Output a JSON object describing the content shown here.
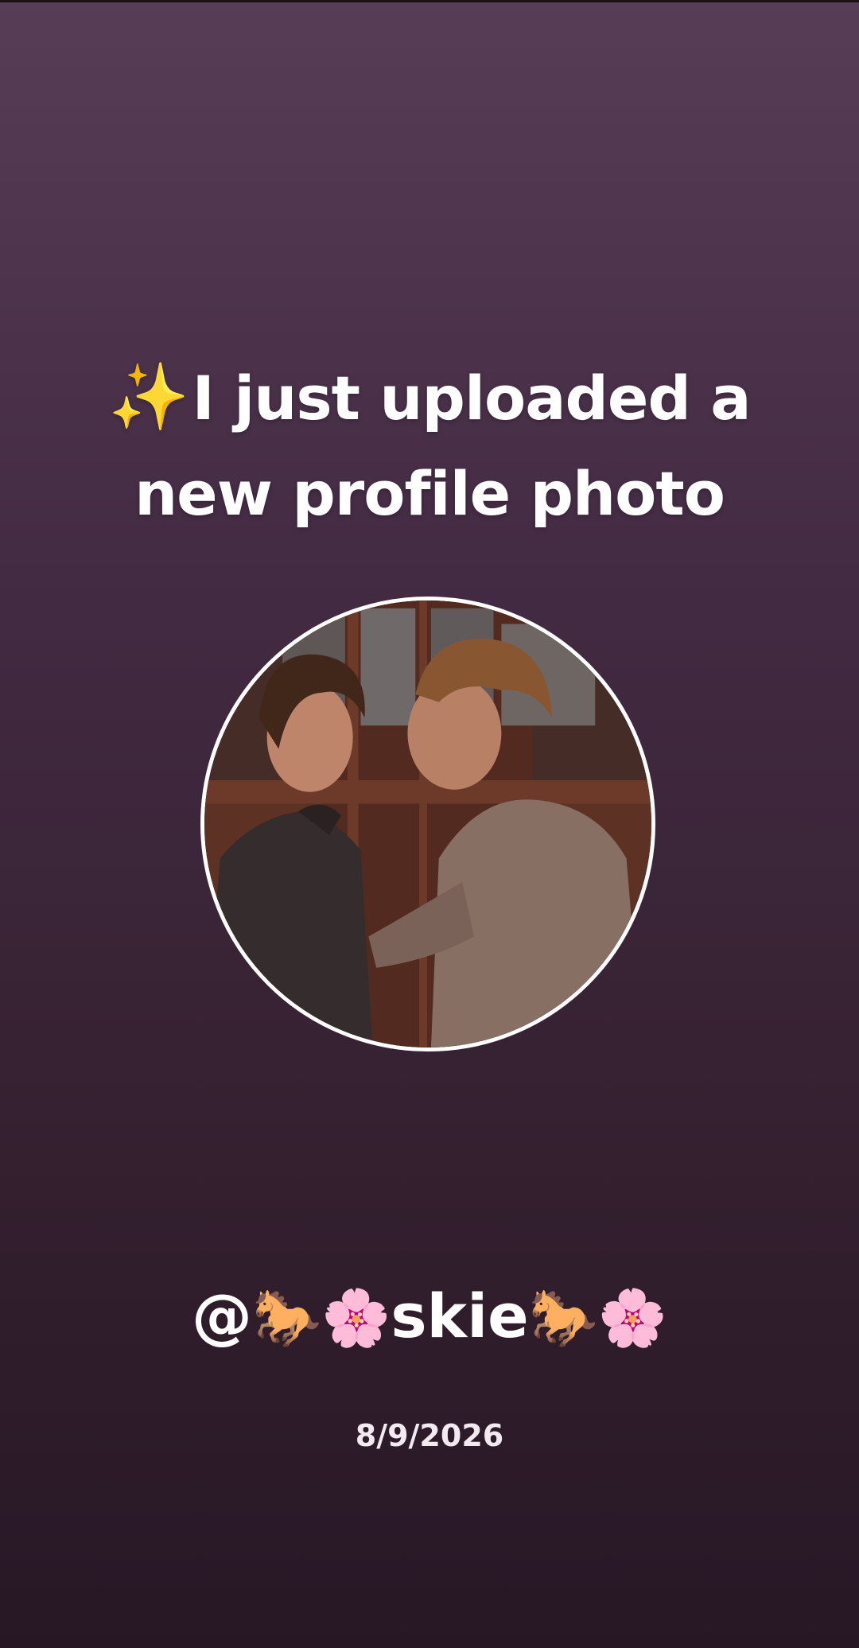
{
  "headline": {
    "sparkle_icon": "✨",
    "text": "I just uploaded a new profile photo"
  },
  "profile_photo": {
    "icon": "profile-photo-two-people"
  },
  "username": {
    "at": "@",
    "horse_emoji": "🐎",
    "blossom_emoji": "🌸",
    "name": "skie"
  },
  "date": "8/9/2026",
  "colors": {
    "background_top": "#573d55",
    "background_bottom": "#271725",
    "text": "#ffffff"
  }
}
